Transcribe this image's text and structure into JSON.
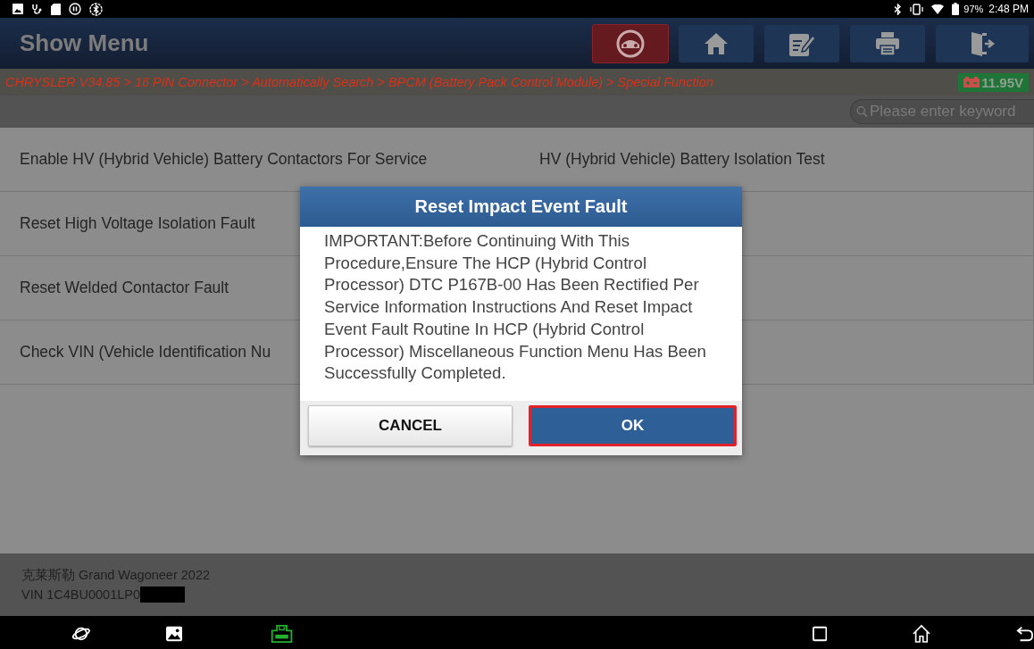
{
  "status_bar": {
    "battery": "97%",
    "time": "2:48 PM"
  },
  "header": {
    "title": "Show Menu",
    "toolbar": [
      {
        "kind": "vehicle",
        "selected": true
      },
      {
        "kind": "home",
        "selected": false
      },
      {
        "kind": "edit",
        "selected": false
      },
      {
        "kind": "print",
        "selected": false
      },
      {
        "kind": "exit",
        "selected": false
      }
    ]
  },
  "breadcrumb": "CHRYSLER V34.85 > 16 PIN Connector > Automatically Search > BPCM (Battery Pack Control Module) > Special Function",
  "voltage": "11.95V",
  "search": {
    "placeholder": "Please enter keyword"
  },
  "menu": {
    "rows": [
      {
        "cells": [
          "Enable HV (Hybrid Vehicle) Battery Contactors For Service",
          "HV (Hybrid Vehicle) Battery Isolation Test"
        ]
      },
      {
        "cells": [
          "Reset High Voltage Isolation Fault"
        ]
      },
      {
        "cells": [
          "Reset Welded Contactor Fault"
        ]
      },
      {
        "cells": [
          "Check VIN (Vehicle Identification Nu"
        ]
      }
    ]
  },
  "dialog": {
    "title": "Reset Impact Event Fault",
    "message": "IMPORTANT:Before Continuing With This Procedure,Ensure The HCP (Hybrid Control Processor) DTC P167B-00 Has Been Rectified Per Service Information Instructions And Reset Impact Event Fault Routine In HCP (Hybrid Control Processor) Miscellaneous Function Menu Has Been Successfully Completed.",
    "buttons": [
      {
        "label": "CANCEL",
        "kind": "secondary",
        "highlighted": false
      },
      {
        "label": "OK",
        "kind": "primary",
        "highlighted": true
      }
    ]
  },
  "footer": {
    "vehicle": "克莱斯勒 Grand Wagoneer 2022",
    "vin": "VIN 1C4BU0001LP0"
  }
}
